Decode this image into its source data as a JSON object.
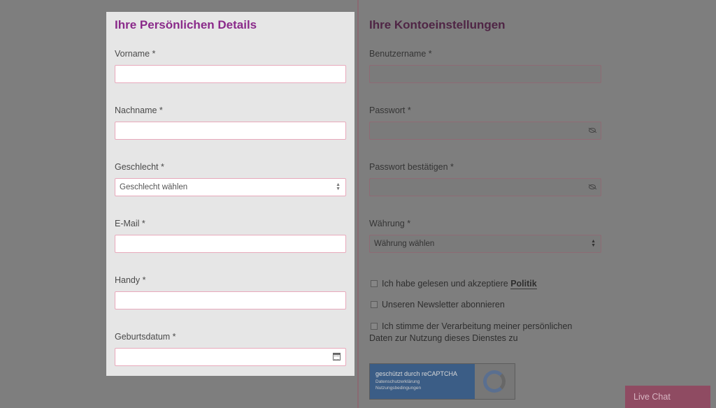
{
  "personal": {
    "title": "Ihre Persönlichen Details",
    "first_name_label": "Vorname *",
    "last_name_label": "Nachname *",
    "gender_label": "Geschlecht *",
    "gender_value": "Geschlecht wählen",
    "email_label": "E-Mail *",
    "mobile_label": "Handy *",
    "birthdate_label": "Geburtsdatum *"
  },
  "account": {
    "title": "Ihre Kontoeinstellungen",
    "username_label": "Benutzername *",
    "password_label": "Passwort *",
    "confirm_label": "Passwort bestätigen *",
    "currency_label": "Währung *",
    "currency_value": "Währung wählen"
  },
  "checkboxes": {
    "terms_text": "Ich habe gelesen und akzeptiere",
    "terms_link": "Politik",
    "newsletter_text": "Unseren Newsletter abonnieren",
    "consent_line1": "Ich stimme der Verarbeitung meiner persönlichen",
    "consent_line2": "Daten zur Nutzung dieses Dienstes zu"
  },
  "recaptcha": {
    "main": "geschützt durch reCAPTCHA",
    "privacy": "Datenschutzerklärung",
    "terms": "Nutzungsbedingungen"
  },
  "livechat": {
    "label": "Live Chat"
  },
  "colors": {
    "accent": "#8a2a8a",
    "input_border": "#e8a9bb",
    "overlay": "#7e7e7e",
    "livechat": "#8f4b62"
  },
  "icons": [
    "calendar-icon",
    "eye-slash-icon",
    "select-arrows-icon",
    "recaptcha-logo-icon"
  ]
}
